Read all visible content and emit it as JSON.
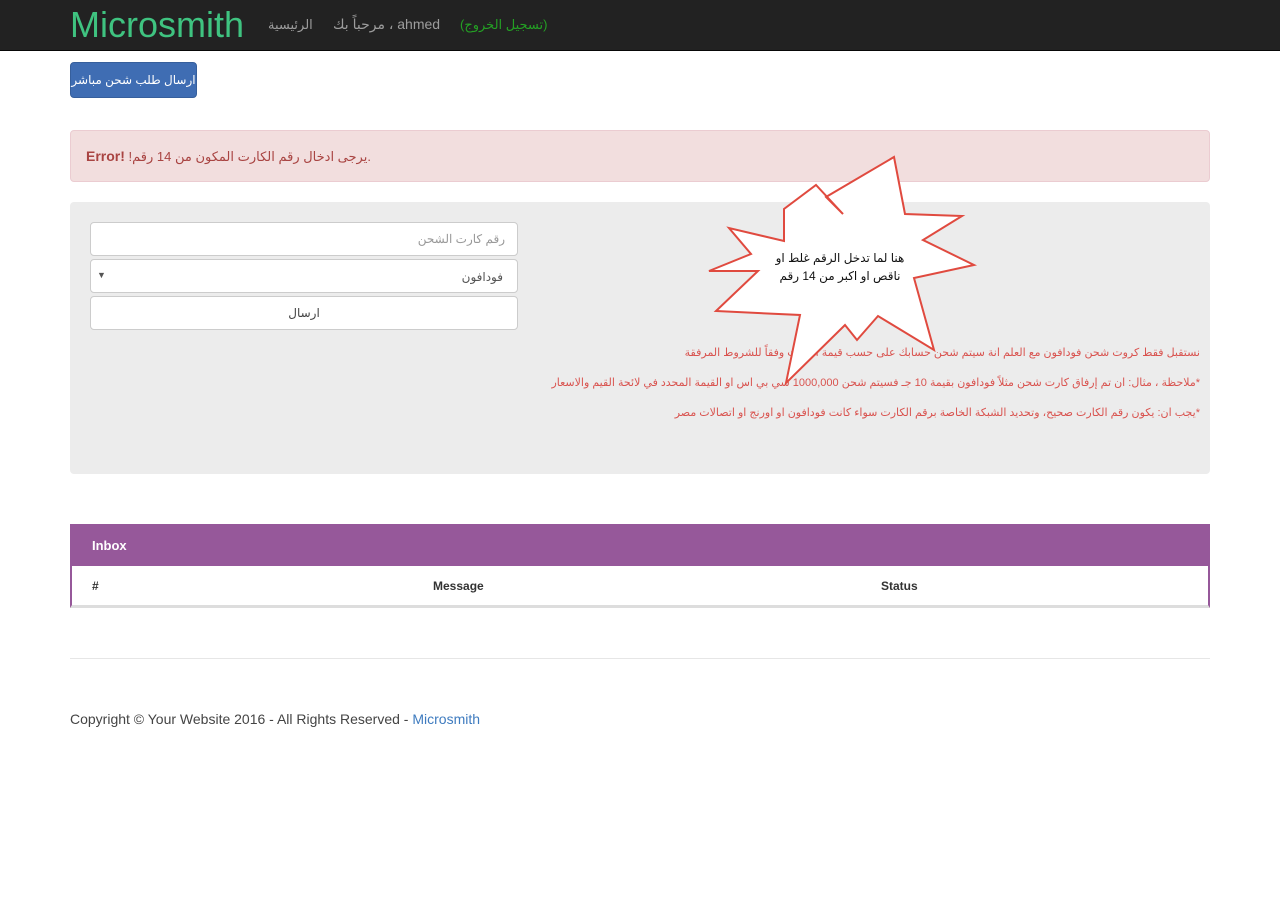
{
  "navbar": {
    "brand": "Microsmith",
    "home": "الرئيسية",
    "welcome": "مرحباً بك ، ahmed",
    "logout": "(تسجيل الخروج)"
  },
  "direct_request_button": "ارسال طلب شحن مباشر",
  "alert": {
    "label": "Error!",
    "message": "!يرجى ادخال رقم الكارت المكون من 14 رقم."
  },
  "form": {
    "card_placeholder": "رقم كارت الشحن",
    "network_selected": "فودافون",
    "submit_label": "ارسال"
  },
  "notes": [
    "نستقبل فقط كروت شحن فودافون مع العلم انة سيتم شحن حسابك على حسب قيمة الكارت وفقاً للشروط المرفقة",
    "*ملاحظة ، مثال: ان تم إرفاق كارت شحن مثلاً فودافون بقيمة 10 جـ فسيتم شحن 1000,000 سي بي اس او القيمة المحدد في لائحة القيم والاسعار",
    "*يجب ان: يكون رقم الكارت صحيح، وتحديد الشبكة الخاصة برقم الكارت سواء كانت فودافون او اورنج او اتصالات مصر"
  ],
  "callout": {
    "text": "هنا لما تدخل الرقم غلط او ناقص او اكبر من 14 رقم"
  },
  "inbox": {
    "title": "Inbox",
    "columns": [
      "#",
      "Message",
      "Status"
    ]
  },
  "footer": {
    "copyright": "Copyright © Your Website 2016 - All Rights Reserved - ",
    "link": "Microsmith"
  }
}
